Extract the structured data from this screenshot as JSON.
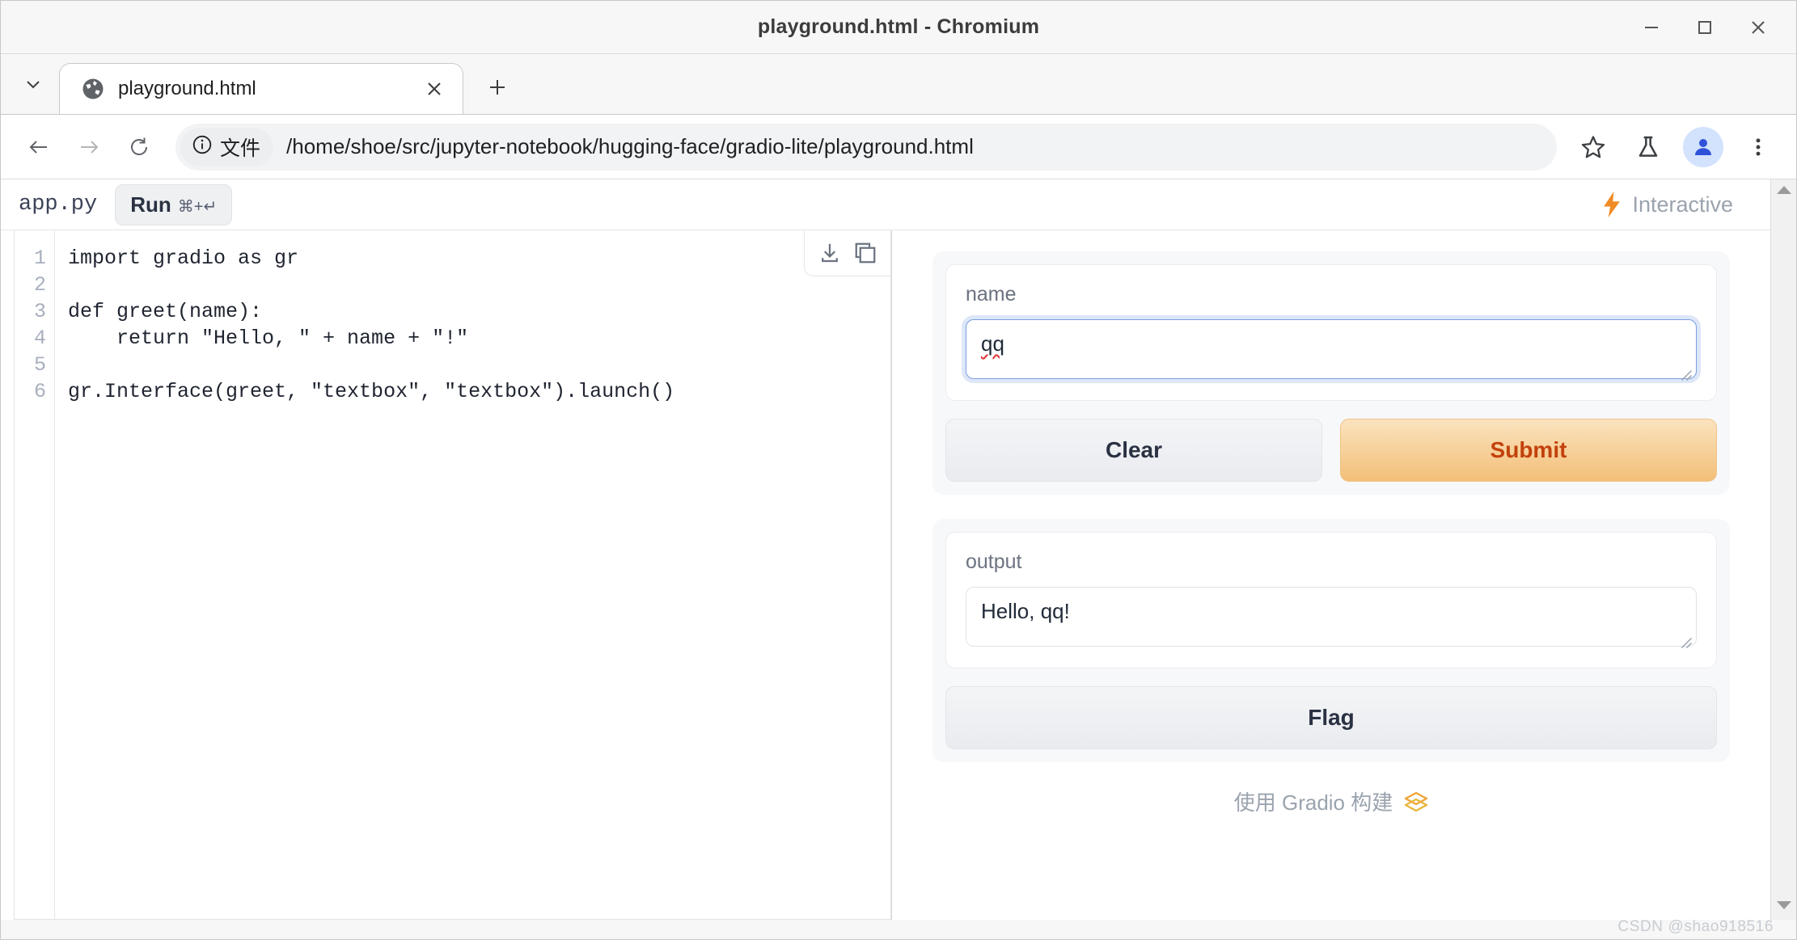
{
  "window": {
    "title": "playground.html - Chromium",
    "controls": {
      "minimize": "minimize-button",
      "maximize": "maximize-button",
      "close": "close-button"
    }
  },
  "tabs": {
    "list_button": "tab-search-chevron",
    "items": [
      {
        "title": "playground.html",
        "favicon": "globe-icon",
        "close": "close-tab-icon"
      }
    ],
    "new_tab": "+"
  },
  "toolbar": {
    "back": "back-arrow-icon",
    "forward": "forward-arrow-icon",
    "reload": "reload-icon",
    "omnibox": {
      "chip_label": "文件",
      "chip_icon": "info-circle-icon",
      "url": "/home/shoe/src/jupyter-notebook/hugging-face/gradio-lite/playground.html"
    },
    "bookmark": "star-icon",
    "labs": "flask-icon",
    "profile": "person-avatar-icon",
    "menu": "three-dot-menu-icon"
  },
  "playground": {
    "filename": "app.py",
    "run_label": "Run",
    "run_shortcut": "⌘+↵",
    "interactive_label": "Interactive",
    "download_icon": "download-icon",
    "copy_icon": "copy-icon",
    "line_numbers": "1\n2\n3\n4\n5\n6",
    "code": "import gradio as gr\n\ndef greet(name):\n    return \"Hello, \" + name + \"!\"\n\ngr.Interface(greet, \"textbox\", \"textbox\").launch()"
  },
  "gradio": {
    "input": {
      "label": "name",
      "value": "qq",
      "placeholder": "",
      "misspelled": true
    },
    "clear_label": "Clear",
    "submit_label": "Submit",
    "output": {
      "label": "output",
      "value": "Hello, qq!"
    },
    "flag_label": "Flag",
    "footer_text": "使用 Gradio 构建",
    "footer_logo": "gradio-logo-icon"
  },
  "colors": {
    "accent_orange": "#f3bf78",
    "submit_text": "#c2410c",
    "focus_blue": "#7b9fe0",
    "bolt_orange": "#f08a24"
  },
  "watermark": "CSDN @shao918516"
}
